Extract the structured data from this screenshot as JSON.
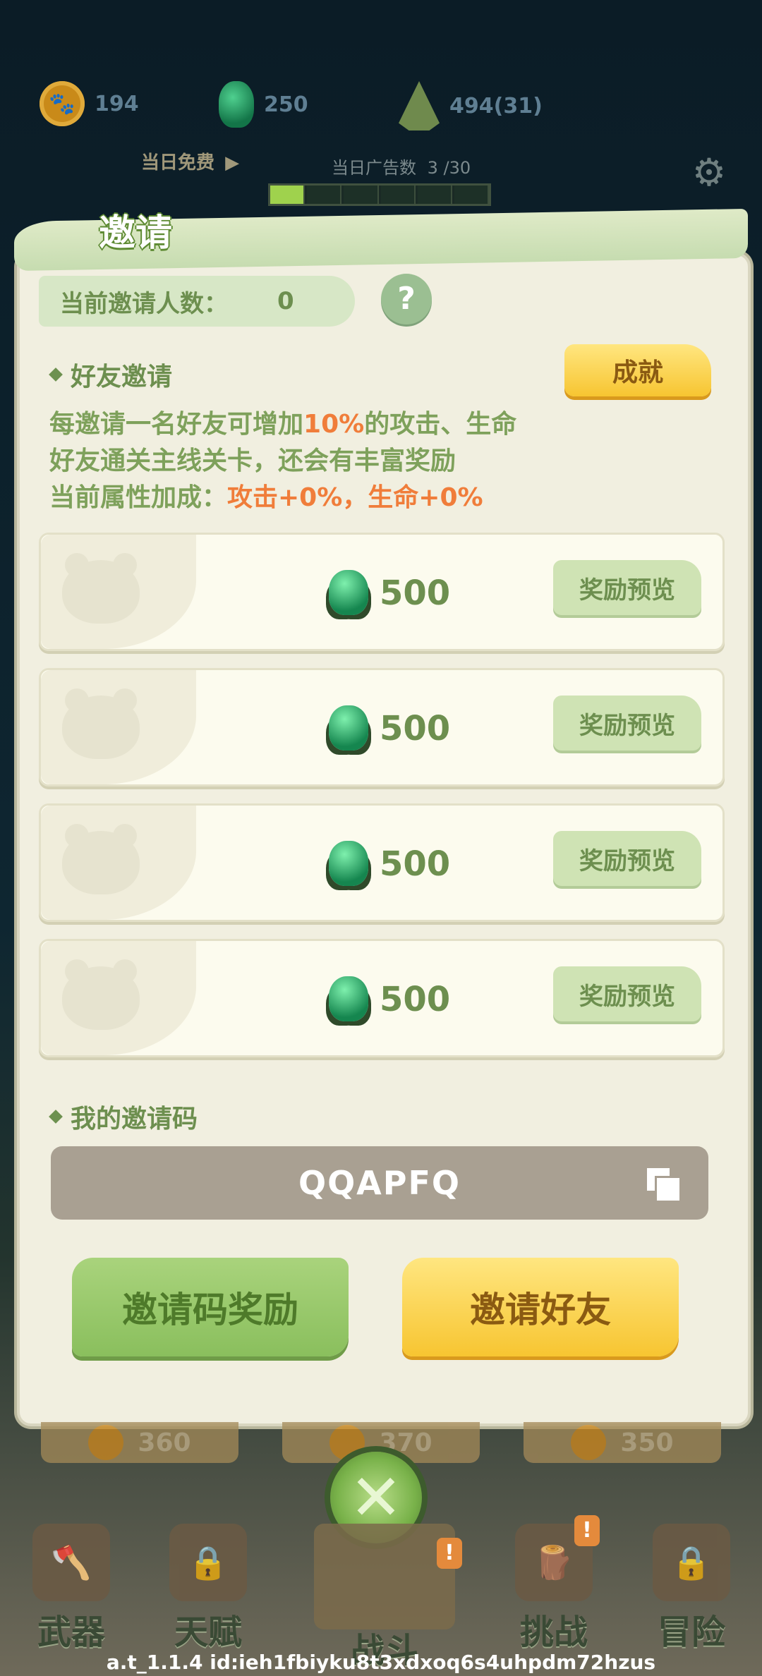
{
  "hud": {
    "paw_coins": "194",
    "gems": "250",
    "bamboo_shoots": "494(31)",
    "daily_free_label": "当日免费",
    "ad_count_label": "当日广告数",
    "ad_count_value": "3 /30",
    "ad_progress_fraction": 0.1
  },
  "panel": {
    "title": "邀请",
    "invite_count_label": "当前邀请人数：",
    "invite_count_value": "0",
    "help_label": "?",
    "friend_invite_title": "好友邀请",
    "achievement_button": "成就",
    "desc_line1_a": "每邀请一名好友可增加",
    "desc_line1_hl": "10%",
    "desc_line1_b": "的攻击、生命",
    "desc_line2": "好友通关主线关卡，还会有丰富奖励",
    "desc_line3_a": "当前属性加成：",
    "desc_line3_hl": "攻击+0%，生命+0%",
    "rewards": [
      {
        "amount": "500",
        "button": "奖励预览"
      },
      {
        "amount": "500",
        "button": "奖励预览"
      },
      {
        "amount": "500",
        "button": "奖励预览"
      },
      {
        "amount": "500",
        "button": "奖励预览"
      }
    ],
    "my_code_title": "我的邀请码",
    "invite_code": "QQAPFQ",
    "code_reward_button": "邀请码奖励",
    "invite_friend_button": "邀请好友"
  },
  "under_panel": [
    "360",
    "370",
    "350"
  ],
  "nav": {
    "weapon": "武器",
    "talent": "天赋",
    "battle": "战斗",
    "challenge": "挑战",
    "adventure": "冒险",
    "badge": "!"
  },
  "footer": "a.t_1.1.4 id:ieh1fbiyku8t3xdxoq6s4uhpdm72hzus",
  "colors": {
    "accent_green": "#6d8f4f",
    "highlight_orange": "#f07d3a",
    "button_yellow": "#f7c531"
  }
}
